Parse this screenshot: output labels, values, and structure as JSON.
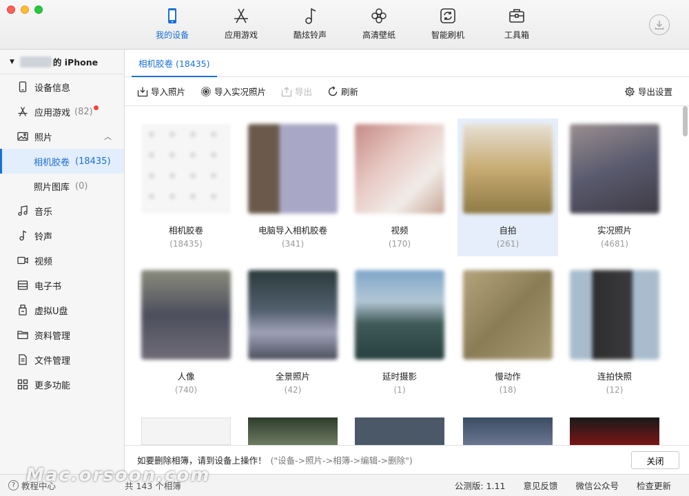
{
  "nav": {
    "items": [
      {
        "label": "我的设备",
        "icon": "phone-icon",
        "active": true
      },
      {
        "label": "应用游戏",
        "icon": "app-store-icon",
        "active": false
      },
      {
        "label": "酷炫铃声",
        "icon": "music-note-icon",
        "active": false
      },
      {
        "label": "高清壁纸",
        "icon": "flower-icon",
        "active": false
      },
      {
        "label": "智能刷机",
        "icon": "refresh-icon",
        "active": false
      },
      {
        "label": "工具箱",
        "icon": "toolbox-icon",
        "active": false
      }
    ],
    "download_icon": "download-icon"
  },
  "sidebar": {
    "device_name": "的 iPhone",
    "items": [
      {
        "label": "设备信息",
        "icon": "device-info-icon"
      },
      {
        "label": "应用游戏",
        "count": "(82)",
        "icon": "app-icon",
        "badge": true
      },
      {
        "label": "照片",
        "icon": "photo-icon",
        "expanded": true
      },
      {
        "label": "相机胶卷",
        "count": "(18435)",
        "sub": true,
        "active": true
      },
      {
        "label": "照片图库",
        "count": "(0)",
        "sub": true
      },
      {
        "label": "音乐",
        "icon": "music-icon"
      },
      {
        "label": "铃声",
        "icon": "bell-icon"
      },
      {
        "label": "视频",
        "icon": "video-icon"
      },
      {
        "label": "电子书",
        "icon": "ebook-icon"
      },
      {
        "label": "虚拟U盘",
        "icon": "usb-icon"
      },
      {
        "label": "资料管理",
        "icon": "folder-icon"
      },
      {
        "label": "文件管理",
        "icon": "file-icon"
      },
      {
        "label": "更多功能",
        "icon": "grid-icon"
      }
    ]
  },
  "main": {
    "tab": "相机胶卷 (18435)",
    "actions": {
      "import_photos": "导入照片",
      "import_live": "导入实况照片",
      "export": "导出",
      "refresh": "刷新",
      "export_settings": "导出设置"
    },
    "albums": [
      {
        "name": "相机胶卷",
        "count": "(18435)"
      },
      {
        "name": "电脑导入相机胶卷",
        "count": "(341)"
      },
      {
        "name": "视频",
        "count": "(170)"
      },
      {
        "name": "自拍",
        "count": "(261)",
        "selected": true
      },
      {
        "name": "实况照片",
        "count": "(4681)"
      },
      {
        "name": "人像",
        "count": "(740)"
      },
      {
        "name": "全景照片",
        "count": "(42)"
      },
      {
        "name": "延时摄影",
        "count": "(1)"
      },
      {
        "name": "慢动作",
        "count": "(18)"
      },
      {
        "name": "连拍快照",
        "count": "(12)"
      }
    ],
    "notice": "如要删除相簿，请到设备上操作！",
    "notice_hint": "(\"设备->照片->相簿->编辑->删除\")",
    "close_label": "关闭"
  },
  "status": {
    "help": "教程中心",
    "albums": "共 143 个相簿",
    "version": "公测版: 1.11",
    "feedback": "意见反馈",
    "wechat": "微信公众号",
    "update": "检查更新"
  },
  "watermark": "Mac.orsoon.com",
  "colors": {
    "accent": "#1a6fd8",
    "badge": "#f2453d"
  }
}
